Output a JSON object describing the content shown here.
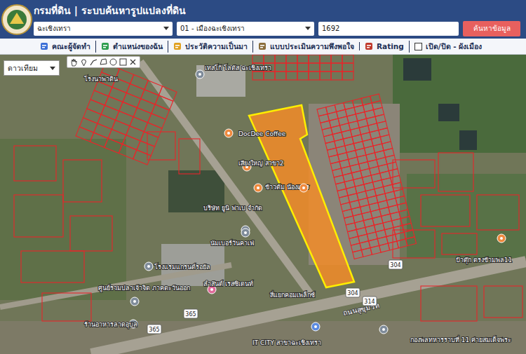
{
  "header": {
    "title": "กรมที่ดิน | ระบบค้นหารูปแปลงที่ดิน"
  },
  "search": {
    "province": "ฉะเชิงเทรา",
    "district": "01 - เมืองฉะเชิงเทรา",
    "parcel_no": "1692",
    "button": "ค้นหาข้อมูล"
  },
  "menu": [
    {
      "label": "คณะผู้จัดทำ",
      "kind": "link",
      "color": "#3b6fd6"
    },
    {
      "label": "ตำแหน่งของฉัน",
      "kind": "link",
      "color": "#2e9e4f"
    },
    {
      "label": "ประวัติความเป็นมา",
      "kind": "link",
      "color": "#e0a020"
    },
    {
      "label": "แบบประเมินความพึงพอใจ",
      "kind": "link",
      "color": "#8a6d3b"
    },
    {
      "label": "Rating",
      "kind": "link",
      "color": "#c0392b"
    },
    {
      "label": "เปิด/ปิด - ผังเมือง",
      "kind": "checkbox",
      "checked": false
    }
  ],
  "map": {
    "layer": "ดาวเทียม",
    "labels": [
      {
        "text": "โรงนาพาดิน",
        "pin_color": ""
      },
      {
        "text": "เทสโก้ โลตัส ฉะเชิงเทรา",
        "pin_color": "#7f8c9a"
      },
      {
        "text": "DocDee Coffee",
        "pin_color": "#f08a3e"
      },
      {
        "text": "เสียงใหญ่ สาขา2",
        "pin_color": "#f08a3e"
      },
      {
        "text": "ข้าวต้ม น้องแพร",
        "pin_color": "#f08a3e"
      },
      {
        "text": "บริษัท ยูนิ ฟาเบ จำกัด",
        "pin_color": "#7f8c9a"
      },
      {
        "text": "นัมเบอร์วันคาเฟ่",
        "pin_color": "#7f8c9a"
      },
      {
        "text": "โรงแรมแกรนด์รอยัล",
        "pin_color": "#7f8c9a"
      },
      {
        "text": "ลำสันต์ เรสซิเดนท์",
        "pin_color": "#e06b9a"
      },
      {
        "text": "สี่แยกคอมเพล็กซ์",
        "pin_color": ""
      },
      {
        "text": "ศูนย์รวมปลาเจ้าจิต ภาคตะวันออก",
        "pin_color": "#7f8c9a"
      },
      {
        "text": "ร้านอาหารลาดอุบล",
        "pin_color": "#7f8c9a"
      },
      {
        "text": "ป้าตุ๊ก ตรงข้ามพล11",
        "pin_color": "#f08a3e"
      },
      {
        "text": "IT CITY สาขาฉะเชิงเทรา",
        "pin_color": "#5c8be0"
      },
      {
        "text": "กองพลทหารราบที่ 11 ค่ายสมเด็จพระ",
        "pin_color": "#7f8c9a"
      }
    ],
    "road_name": "ถนนสุขุมวิท",
    "road_shields": [
      "304",
      "304",
      "314",
      "365",
      "365"
    ]
  }
}
